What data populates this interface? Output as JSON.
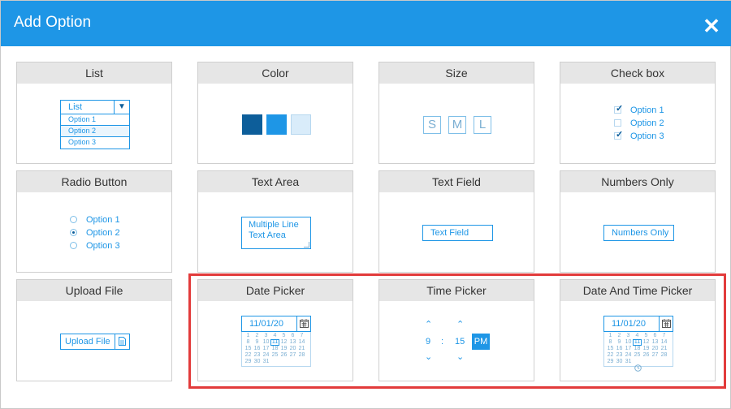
{
  "dialog": {
    "title": "Add Option",
    "close_icon": "close-icon"
  },
  "colors": {
    "header": "#1e96e6",
    "accent": "#1e96e6",
    "dark_blue": "#0d5e9a",
    "highlight_border": "#e23b3b",
    "swatches": [
      "#0d5e9a",
      "#1e96e6",
      "#d9ecfa"
    ]
  },
  "cards": {
    "list": {
      "title": "List",
      "dropdown_value": "List",
      "options": [
        "Option 1",
        "Option 2",
        "Option 3"
      ]
    },
    "color": {
      "title": "Color"
    },
    "size": {
      "title": "Size",
      "sizes": [
        "S",
        "M",
        "L"
      ]
    },
    "checkbox": {
      "title": "Check box",
      "options": [
        "Option 1",
        "Option 2",
        "Option 3"
      ],
      "checked": [
        true,
        false,
        true
      ]
    },
    "radio": {
      "title": "Radio Button",
      "options": [
        "Option 1",
        "Option 2",
        "Option 3"
      ],
      "selected_index": 1
    },
    "textarea": {
      "title": "Text Area",
      "line1": "Multiple Line",
      "line2": "Text Area"
    },
    "textfield": {
      "title": "Text Field",
      "value": "Text Field"
    },
    "numbers": {
      "title": "Numbers Only",
      "value": "Numbers Only"
    },
    "upload": {
      "title": "Upload File",
      "button": "Upload File"
    },
    "datepicker": {
      "title": "Date Picker",
      "value": "11/01/20",
      "days": [
        [
          "1",
          "2",
          "3",
          "4",
          "5",
          "6",
          "7"
        ],
        [
          "8",
          "9",
          "10",
          "11",
          "12",
          "13",
          "14"
        ],
        [
          "15",
          "16",
          "17",
          "18",
          "19",
          "20",
          "21"
        ],
        [
          "22",
          "23",
          "24",
          "25",
          "26",
          "27",
          "28"
        ],
        [
          "29",
          "30",
          "31",
          "",
          "",
          "",
          ""
        ]
      ],
      "today": "11"
    },
    "timepicker": {
      "title": "Time Picker",
      "hour": "9",
      "separator": ":",
      "minute": "15",
      "period": "PM"
    },
    "datetimepicker": {
      "title": "Date And Time Picker",
      "value": "11/01/20",
      "days": [
        [
          "1",
          "2",
          "3",
          "4",
          "5",
          "6",
          "7"
        ],
        [
          "8",
          "9",
          "10",
          "11",
          "12",
          "13",
          "14"
        ],
        [
          "15",
          "16",
          "17",
          "18",
          "19",
          "20",
          "21"
        ],
        [
          "22",
          "23",
          "24",
          "25",
          "26",
          "27",
          "28"
        ],
        [
          "29",
          "30",
          "31",
          "",
          "",
          "",
          ""
        ]
      ],
      "today": "11"
    }
  }
}
